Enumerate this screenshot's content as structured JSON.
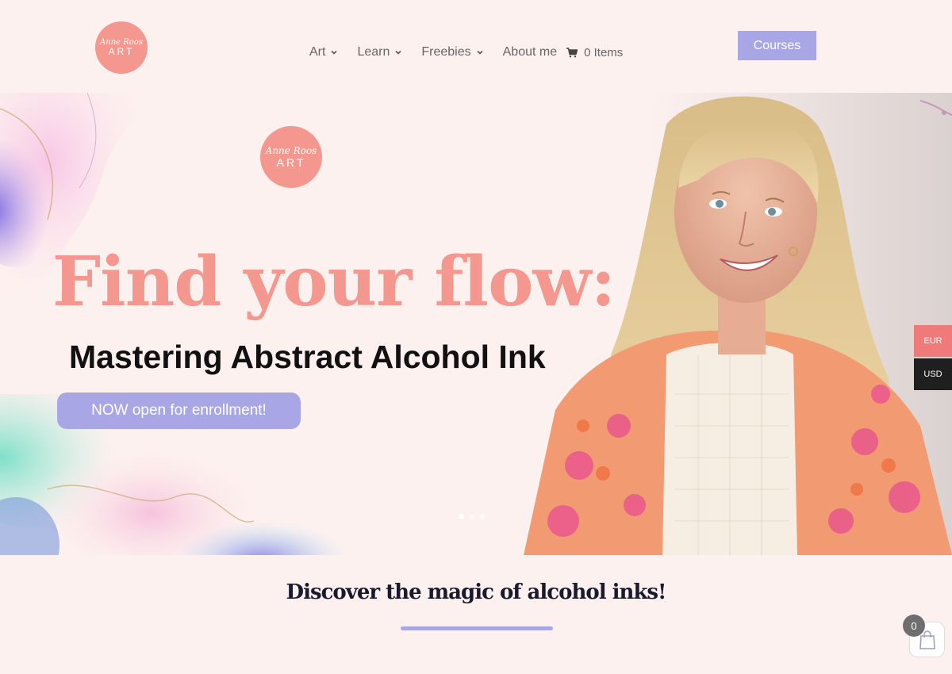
{
  "header": {
    "logo": {
      "script": "Anne Roos",
      "word": "ART"
    },
    "nav": [
      {
        "label": "Art",
        "has_dropdown": true
      },
      {
        "label": "Learn",
        "has_dropdown": true
      },
      {
        "label": "Freebies",
        "has_dropdown": true
      },
      {
        "label": "About me",
        "has_dropdown": false
      }
    ],
    "cart": {
      "icon": "cart-icon",
      "label": "0 Items"
    },
    "courses_button": "Courses"
  },
  "hero": {
    "logo": {
      "script": "Anne Roos",
      "word": "ART"
    },
    "headline": "Find your flow:",
    "subline": "Mastering Abstract Alcohol Ink",
    "cta": "NOW open for enrollment!",
    "slides": 3,
    "active_slide": 1
  },
  "currency": {
    "eur": "EUR",
    "usd": "USD"
  },
  "section": {
    "heading": "Discover the magic of alcohol inks!"
  },
  "floating_cart": {
    "count": "0",
    "icon": "shopping-bag-icon"
  },
  "colors": {
    "accent": "#f4978e",
    "button": "#a9a6e6",
    "background": "#fdf1ef",
    "eur": "#f07a7a",
    "usd": "#1f1f1f"
  }
}
